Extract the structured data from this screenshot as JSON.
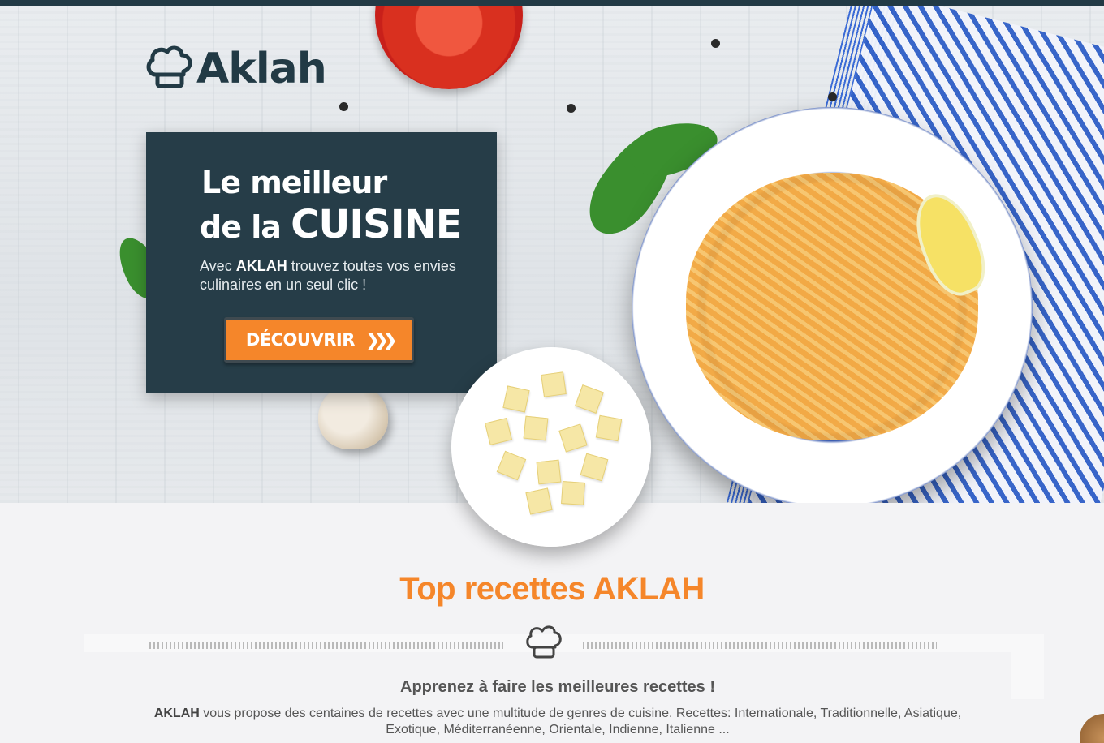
{
  "brand": {
    "logo_text": "Aklah"
  },
  "hero": {
    "headline_line1": "Le meilleur",
    "headline_line2_prefix": "de la",
    "headline_line2_emphasis": "CUISINE",
    "desc_prefix": "Avec",
    "desc_brand": "AKLAH",
    "desc_rest": "trouvez toutes vos envies culinaires en un seul clic !",
    "cta_label": "DÉCOUVRIR",
    "cta_icon": "double-chevron-right-icon"
  },
  "top_recipes": {
    "title_light": "Top",
    "title_bold": "recettes AKLAH",
    "divider_icon": "chef-hat-icon",
    "subtitle": "Apprenez à faire les meilleures recettes !",
    "desc_brand": "AKLAH",
    "desc_rest": "vous propose des centaines de recettes avec une multitude de genres de cuisine. Recettes: Internationale, Traditionnelle, Asiatique, Exotique, Méditerranéenne, Orientale, Indienne, Italienne ..."
  },
  "colors": {
    "accent": "#f5862a",
    "dark": "#263d48",
    "topbar": "#223a45"
  }
}
